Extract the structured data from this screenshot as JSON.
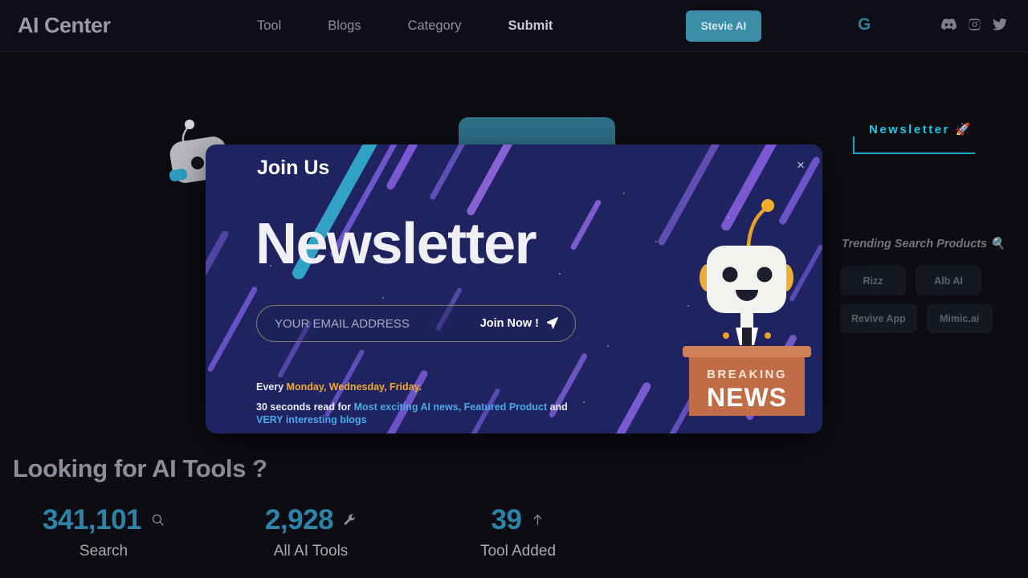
{
  "header": {
    "logo": "AI Center",
    "nav": [
      {
        "label": "Tool",
        "strong": false
      },
      {
        "label": "Blogs",
        "strong": false
      },
      {
        "label": "Category",
        "strong": false
      },
      {
        "label": "Submit",
        "strong": true
      }
    ],
    "cta_label": "Stevie AI",
    "google_icon": "G",
    "social_icons": [
      "discord-icon",
      "instagram-icon",
      "twitter-icon"
    ],
    "accent_color": "#3b8da8"
  },
  "modal": {
    "eyebrow": "Join Us",
    "title": "Newsletter",
    "close_label": "×",
    "email_placeholder": "YOUR EMAIL ADDRESS",
    "email_value": "",
    "submit_label": "Join Now !",
    "submit_icon": "paper-plane-icon",
    "note_1_prefix": "Every ",
    "note_1_days": "Monday, Wednesday, Friday.",
    "note_2_prefix": "30 seconds read for ",
    "note_2_link_1": "Most exciting AI news, Featured Product",
    "note_2_mid": " and ",
    "note_2_link_2": "VERY interesting blogs",
    "illustration": {
      "name": "news-robot-icon",
      "desk_line_1": "BREAKING",
      "desk_line_2": "NEWS"
    },
    "bg_color": "#1f2461",
    "accent_amber": "#f0ab2d",
    "accent_blue": "#4aa8e8"
  },
  "sidebar": {
    "newsletter_title": "Newsletter",
    "newsletter_emoji": "🚀",
    "trending_title": "Trending Search Products",
    "trending_emoji": "🔍",
    "tags": [
      {
        "label": "Rizz"
      },
      {
        "label": "Alb AI"
      },
      {
        "label": "Revive App"
      },
      {
        "label": "Mimic.ai"
      }
    ],
    "accent_color": "#19c9e0"
  },
  "main": {
    "heading": "Looking for AI Tools ?",
    "stats": [
      {
        "value": "341,101",
        "label": "Search",
        "label_2": "",
        "icon": "search-icon"
      },
      {
        "value": "2,928",
        "label": "All AI Tools",
        "label_2": "",
        "icon": "wrench-icon"
      },
      {
        "value": "39",
        "label": "Tool Added",
        "label_2": "",
        "icon": "arrow-up-icon"
      }
    ],
    "stat_color": "#2e84a8"
  }
}
